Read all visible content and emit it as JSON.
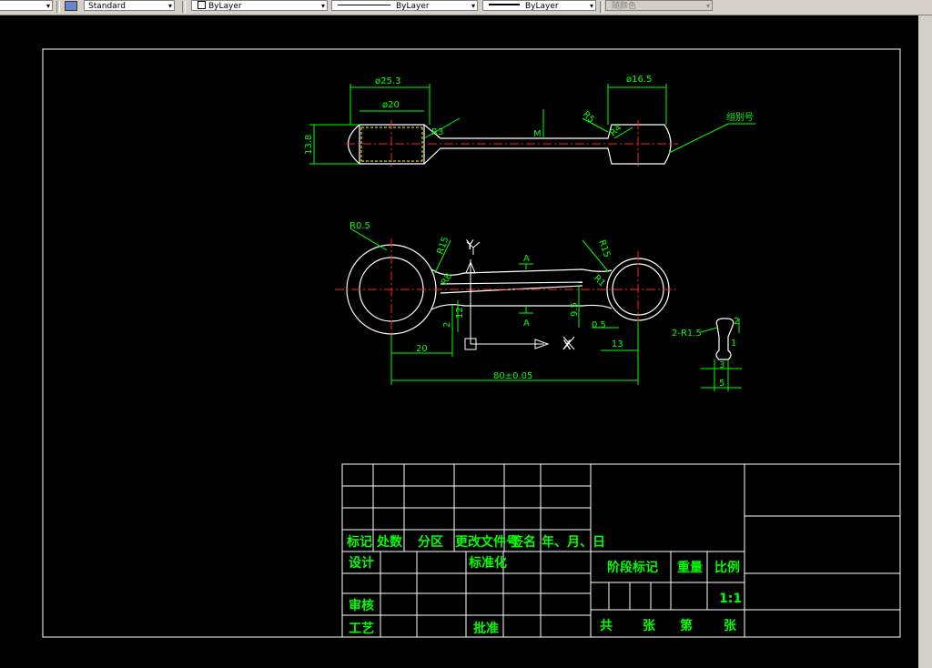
{
  "toolbar": {
    "left_arrow": "▾",
    "text_style": "Standard",
    "layer": "ByLayer",
    "linetype": "ByLayer",
    "lineweight": "ByLayer",
    "color": "随颜色"
  },
  "drawing": {
    "dims": {
      "d25": "ø25.3",
      "d20": "ø20",
      "d16": "ø16.5",
      "h13": "13.8",
      "r3": "R3",
      "r5": "R5",
      "r4": "R4",
      "m": "M",
      "label_group": "组别号",
      "r05": "R0.5",
      "r15a": "R15",
      "r15b": "R15",
      "r8": "R8",
      "r1": "R1",
      "A_top": "A",
      "A_bot": "A",
      "y": "Y",
      "x": "X",
      "n2": "2",
      "n12": "12",
      "n95": "9.5",
      "n05": "0.5",
      "n20": "20",
      "n13": "13",
      "n80": "80±0.05",
      "sec": "2-R1.5",
      "sec_s3": "3",
      "sec_s5": "5",
      "sec_s2": "2",
      "sec_s1": "1"
    },
    "title_block": {
      "h_mark": "标记",
      "h_count": "处数",
      "h_zone": "分区",
      "h_doc": "更改文件号",
      "h_sign": "签名",
      "h_date": "年、月、日",
      "design": "设计",
      "standard": "标准化",
      "review": "审核",
      "process": "工艺",
      "approve": "批准",
      "stage": "阶段标记",
      "weight": "重量",
      "scale_label": "比例",
      "scale": "1:1",
      "total": "共",
      "sheets": "张",
      "nth": "第",
      "sheet2": "张"
    }
  }
}
